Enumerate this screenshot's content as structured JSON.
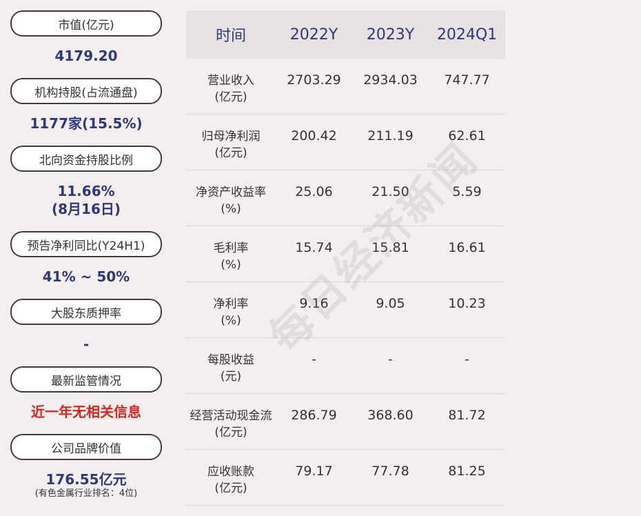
{
  "left_panel": [
    {
      "label": "市值(亿元)",
      "value": "4179.20"
    },
    {
      "label": "机构持股(占流通盘)",
      "value": "1177家(15.5%)"
    },
    {
      "label": "北向资金持股比例",
      "value_line1": "11.66%",
      "value_line2": "(8月16日)"
    },
    {
      "label": "预告净利同比(Y24H1)",
      "value": "41% ~ 50%"
    },
    {
      "label": "大股东质押率",
      "value": "-"
    },
    {
      "label": "最新监管情况",
      "value": "近一年无相关信息",
      "value_color": "#d9251c"
    },
    {
      "label": "公司品牌价值",
      "value": "176.55亿元",
      "sub": "(有色金属行业排名：4位)"
    }
  ],
  "table": {
    "headers": [
      "时间",
      "2022Y",
      "2023Y",
      "2024Q1"
    ],
    "rows": [
      {
        "label1": "营业收入",
        "label2": "(亿元)",
        "values": [
          "2703.29",
          "2934.03",
          "747.77"
        ]
      },
      {
        "label1": "归母净利润",
        "label2": "(亿元)",
        "values": [
          "200.42",
          "211.19",
          "62.61"
        ]
      },
      {
        "label1": "净资产收益率",
        "label2": "(%)",
        "values": [
          "25.06",
          "21.50",
          "5.59"
        ]
      },
      {
        "label1": "毛利率",
        "label2": "(%)",
        "values": [
          "15.74",
          "15.81",
          "16.61"
        ]
      },
      {
        "label1": "净利率",
        "label2": "(%)",
        "values": [
          "9.16",
          "9.05",
          "10.23"
        ]
      },
      {
        "label1": "每股收益",
        "label2": "(元)",
        "values": [
          "-",
          "-",
          "-"
        ]
      },
      {
        "label1": "经营活动现金流",
        "label2": "(亿元)",
        "values": [
          "286.79",
          "368.60",
          "81.72"
        ]
      },
      {
        "label1": "应收账款",
        "label2": "(亿元)",
        "values": [
          "79.17",
          "77.78",
          "81.25"
        ]
      }
    ]
  },
  "watermark": "每日经济新闻",
  "colors": {
    "accent": "#2c3a7a",
    "alert": "#d9251c",
    "background": "#f4eeee",
    "header_bg": "#e8e1e1"
  }
}
